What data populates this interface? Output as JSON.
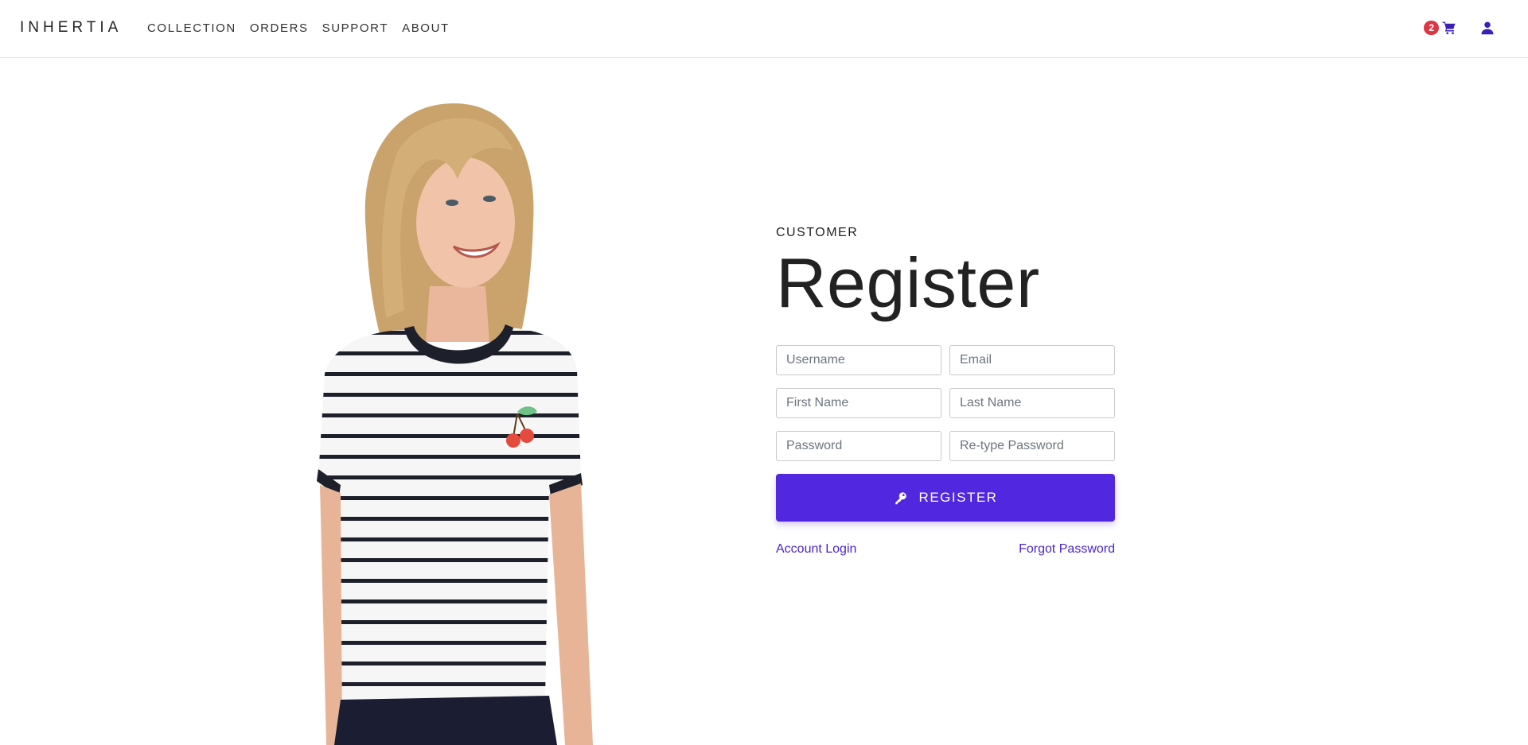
{
  "header": {
    "brand": "INHERTIA",
    "nav": [
      {
        "label": "COLLECTION"
      },
      {
        "label": "ORDERS"
      },
      {
        "label": "SUPPORT"
      },
      {
        "label": "ABOUT"
      }
    ],
    "cart_count": "2",
    "icons": {
      "cart": "shopping-cart-icon",
      "user": "user-icon"
    }
  },
  "hero": {
    "image": "woman-striped-tshirt-photo"
  },
  "form": {
    "eyebrow": "CUSTOMER",
    "title": "Register",
    "fields": {
      "username": {
        "placeholder": "Username",
        "value": ""
      },
      "email": {
        "placeholder": "Email",
        "value": ""
      },
      "first_name": {
        "placeholder": "First Name",
        "value": ""
      },
      "last_name": {
        "placeholder": "Last Name",
        "value": ""
      },
      "password": {
        "placeholder": "Password",
        "value": ""
      },
      "retype_password": {
        "placeholder": "Re-type Password",
        "value": ""
      }
    },
    "submit_label": "REGISTER",
    "submit_icon": "key-icon",
    "login_link": "Account Login",
    "forgot_link": "Forgot Password"
  },
  "colors": {
    "accent": "#5227e0",
    "link": "#4a24c8",
    "badge": "#dc3545"
  }
}
